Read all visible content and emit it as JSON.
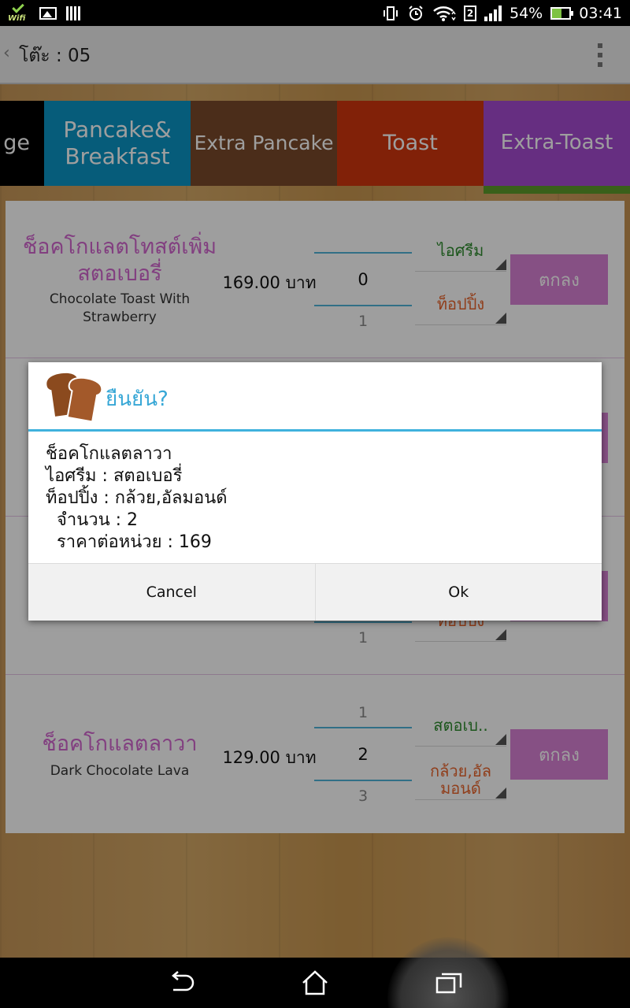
{
  "status_bar": {
    "battery": "54%",
    "time": "03:41",
    "sim_slot": "2",
    "wifi_badge": "Wifi"
  },
  "action_bar": {
    "title": "โต๊ะ : 05"
  },
  "tabs": [
    {
      "label": "ge",
      "color": "#000000"
    },
    {
      "label": "Pancake&\nBreakfast",
      "color": "#0a95c6"
    },
    {
      "label": "Extra Pancake",
      "color": "#7a4a2a"
    },
    {
      "label": "Toast",
      "color": "#d1360e"
    },
    {
      "label": "Extra-Toast",
      "color": "#a54bd0"
    }
  ],
  "items": [
    {
      "name_th": "ช็อคโกแลตโทสต์เพิ่มสตอเบอรี่",
      "name_en": "Chocolate Toast With Strawberry",
      "price": "169.00 บาท",
      "qty_prev": "",
      "qty": "0",
      "qty_next": "1",
      "icecream": "ไอศรีม",
      "topping": "ท็อปปิ้ง",
      "ok_label": "ตกลง"
    },
    {
      "name_th": "ช็อคโกแลตลาวา",
      "name_en": "Dark Chocolate Lava",
      "price": "129.00 บาท",
      "qty_prev": "1",
      "qty": "2",
      "qty_next": "3",
      "icecream": "สตอเบ..",
      "topping": "กล้วย,อัลมอนด์",
      "ok_label": "ตกลง"
    }
  ],
  "partial_item": {
    "qty_next": "1",
    "topping": "ท็อปปิ้ง"
  },
  "dialog": {
    "title": "ยืนยัน?",
    "lines": [
      "ช็อคโกแลตลาวา",
      "ไอศรีม : สตอเบอรี่",
      "ท็อปปิ้ง : กล้วย,อัลมอนด์",
      "  จำนวน : 2",
      "  ราคาต่อหน่วย : 169"
    ],
    "cancel_label": "Cancel",
    "ok_label": "Ok"
  }
}
